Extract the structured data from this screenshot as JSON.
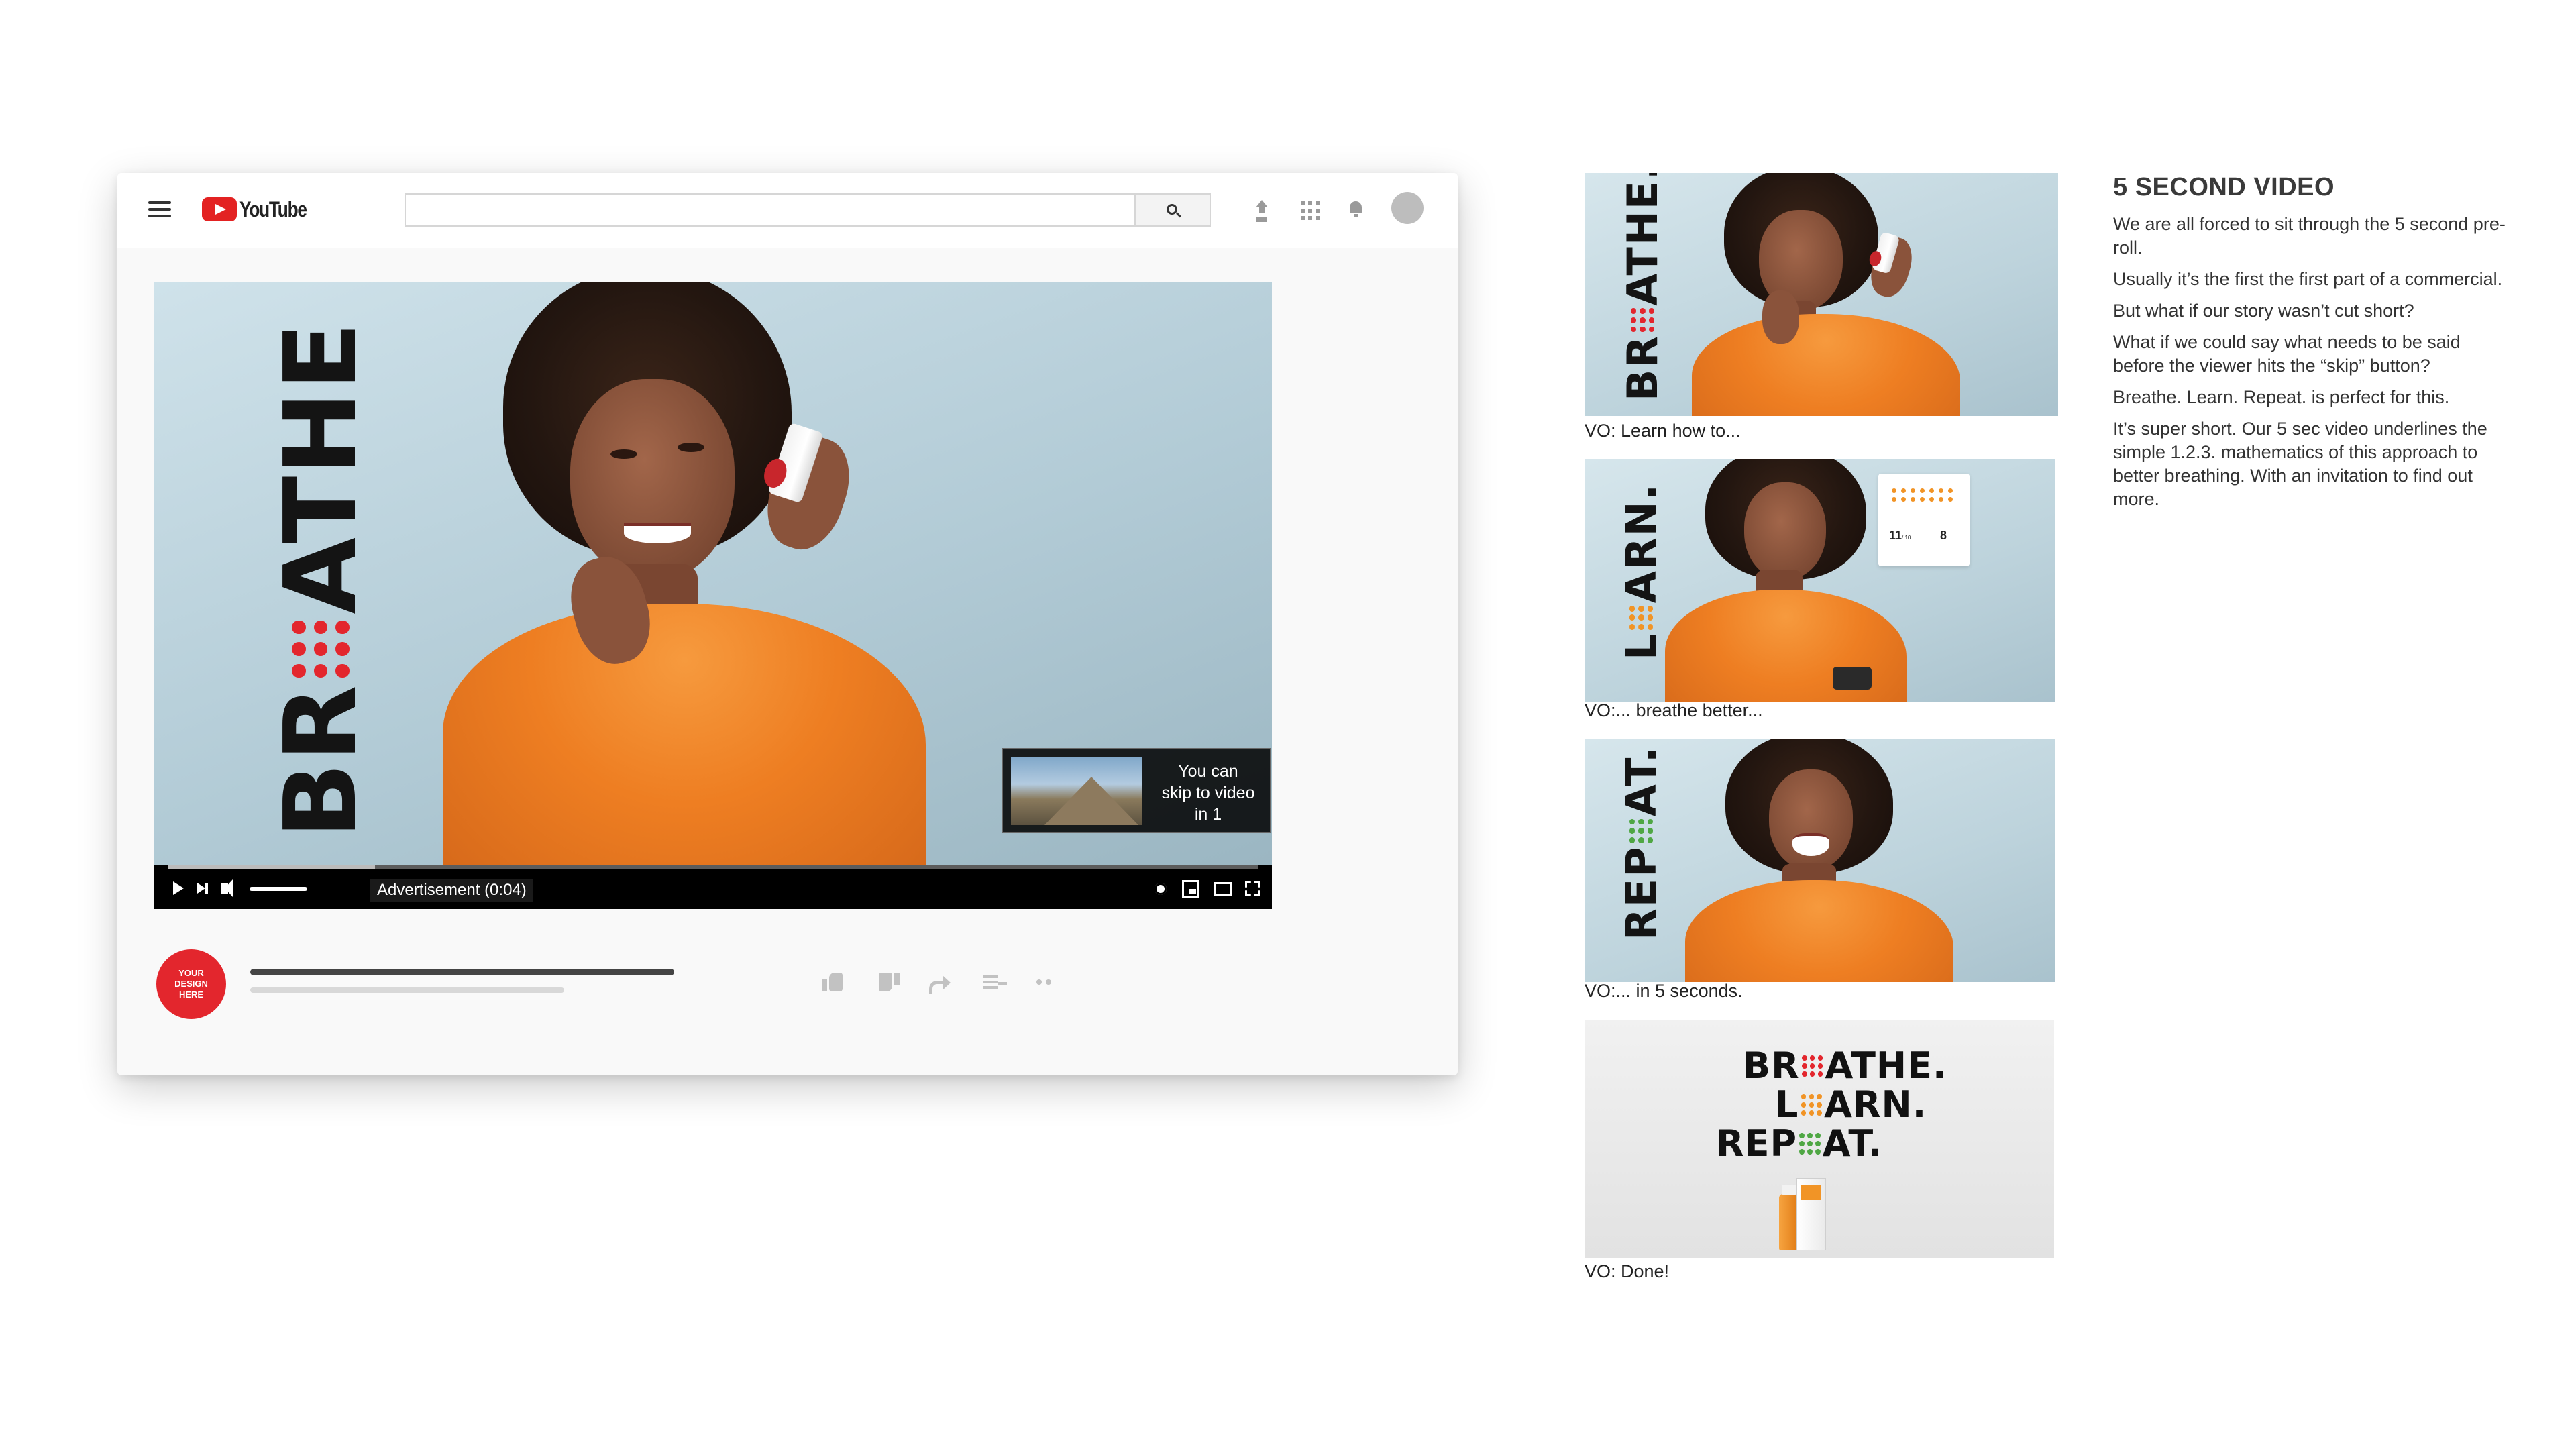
{
  "youtube": {
    "logo_text": "YouTube",
    "search": {
      "value": "",
      "placeholder": ""
    },
    "player": {
      "wordmark": {
        "left": "BR",
        "right": "ATHE",
        "dots": "red"
      },
      "skip": {
        "line1": "You can",
        "line2": "skip to video",
        "line3": "in 1"
      },
      "ad_label": "Advertisement (0:04)",
      "progress": 0.19
    },
    "channel_badge": {
      "line1": "YOUR",
      "line2": "DESIGN",
      "line3": "HERE"
    }
  },
  "storyboard": {
    "frames": [
      {
        "word_left": "BR",
        "word_right": "ATHE.",
        "dots": "red",
        "caption": "VO: Learn how to..."
      },
      {
        "word_left": "L",
        "word_right": "ARN.",
        "dots": "orange",
        "caption": "VO:... breathe better...",
        "stats": {
          "left_value": "11",
          "left_unit": "/ 10",
          "right_value": "8"
        }
      },
      {
        "word_left": "REP",
        "word_right": "AT.",
        "dots": "green",
        "caption": "VO:... in 5 seconds."
      },
      {
        "caption": "VO: Done!",
        "lockup": [
          {
            "left": "BR",
            "right": "ATHE.",
            "dots": "red"
          },
          {
            "left": "L",
            "right": "ARN.",
            "dots": "orange"
          },
          {
            "left": "REP",
            "right": "AT.",
            "dots": "green"
          }
        ]
      }
    ]
  },
  "copy": {
    "heading": "5 SECOND VIDEO",
    "paragraphs": [
      "We are all forced to sit through the 5 second pre-roll.",
      "Usually it’s the first the first part of a commercial.",
      "But what if our story wasn’t cut short?",
      "What if we could say what needs to be said before the viewer hits the “skip” button?",
      "Breathe. Learn. Repeat. is perfect for this.",
      "It’s super short. Our 5 sec video underlines the simple 1.2.3. mathematics of this approach to better breathing. With an invitation to find out more."
    ]
  },
  "colors": {
    "red": "#e3262d",
    "orange": "#f19426",
    "green": "#4fa744",
    "sweater": "#ee7e22",
    "background_blue": "#b2cbd6"
  }
}
